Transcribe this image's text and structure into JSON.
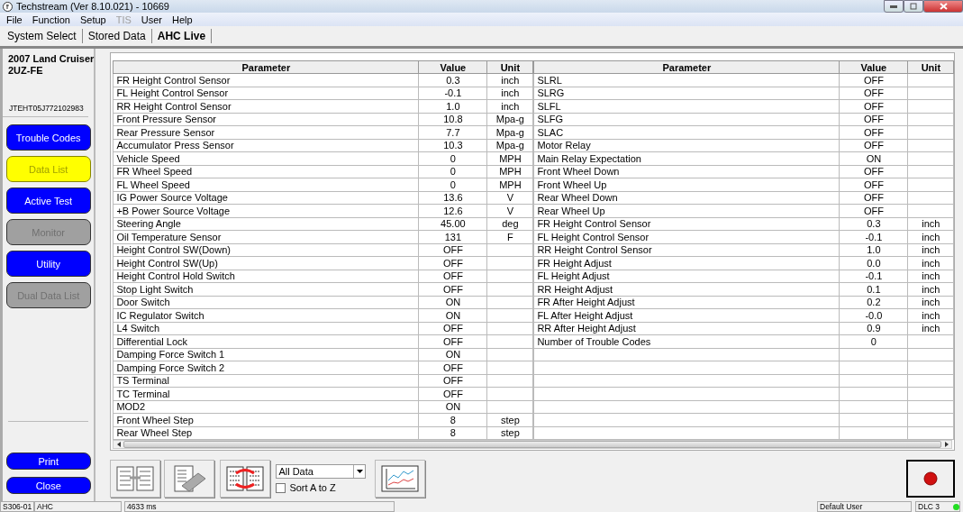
{
  "window": {
    "title": "Techstream (Ver 8.10.021) - 10669"
  },
  "menu": [
    {
      "label": "File",
      "disabled": false
    },
    {
      "label": "Function",
      "disabled": false
    },
    {
      "label": "Setup",
      "disabled": false
    },
    {
      "label": "TIS",
      "disabled": true
    },
    {
      "label": "User",
      "disabled": false
    },
    {
      "label": "Help",
      "disabled": false
    }
  ],
  "tabs": [
    {
      "label": "System Select",
      "selected": false
    },
    {
      "label": "Stored Data",
      "selected": false
    },
    {
      "label": "AHC Live",
      "selected": true
    }
  ],
  "sidebar": {
    "vehicle": [
      "2007 Land Cruiser",
      "2UZ-FE"
    ],
    "vin": "JTEHT05J772102983",
    "buttons": [
      {
        "label": "Trouble Codes",
        "selected": false,
        "disabled": false
      },
      {
        "label": "Data List",
        "selected": true,
        "disabled": false
      },
      {
        "label": "Active Test",
        "selected": false,
        "disabled": false
      },
      {
        "label": "Monitor",
        "selected": false,
        "disabled": true
      },
      {
        "label": "Utility",
        "selected": false,
        "disabled": false
      },
      {
        "label": "Dual Data List",
        "selected": false,
        "disabled": true
      }
    ],
    "actions": [
      "Print",
      "Close"
    ]
  },
  "tables": [
    {
      "columns": [
        "Parameter",
        "Value",
        "Unit"
      ],
      "rows": [
        [
          "FR Height Control Sensor",
          "0.3",
          "inch"
        ],
        [
          "FL Height Control Sensor",
          "-0.1",
          "inch"
        ],
        [
          "RR Height Control Sensor",
          "1.0",
          "inch"
        ],
        [
          "Front Pressure Sensor",
          "10.8",
          "Mpa-g"
        ],
        [
          "Rear Pressure Sensor",
          "7.7",
          "Mpa-g"
        ],
        [
          "Accumulator Press Sensor",
          "10.3",
          "Mpa-g"
        ],
        [
          "Vehicle Speed",
          "0",
          "MPH"
        ],
        [
          "FR Wheel Speed",
          "0",
          "MPH"
        ],
        [
          "FL Wheel Speed",
          "0",
          "MPH"
        ],
        [
          "IG Power Source Voltage",
          "13.6",
          "V"
        ],
        [
          "+B Power Source Voltage",
          "12.6",
          "V"
        ],
        [
          "Steering Angle",
          "45.00",
          "deg"
        ],
        [
          "Oil Temperature Sensor",
          "131",
          "F"
        ],
        [
          "Height Control SW(Down)",
          "OFF",
          ""
        ],
        [
          "Height Control SW(Up)",
          "OFF",
          ""
        ],
        [
          "Height Control Hold Switch",
          "OFF",
          ""
        ],
        [
          "Stop Light Switch",
          "OFF",
          ""
        ],
        [
          "Door Switch",
          "ON",
          ""
        ],
        [
          "IC Regulator Switch",
          "ON",
          ""
        ],
        [
          "L4 Switch",
          "OFF",
          ""
        ],
        [
          "Differential Lock",
          "OFF",
          ""
        ],
        [
          "Damping Force Switch 1",
          "ON",
          ""
        ],
        [
          "Damping Force Switch 2",
          "OFF",
          ""
        ],
        [
          "TS Terminal",
          "OFF",
          ""
        ],
        [
          "TC Terminal",
          "OFF",
          ""
        ],
        [
          "MOD2",
          "ON",
          ""
        ],
        [
          "Front Wheel Step",
          "8",
          "step"
        ],
        [
          "Rear Wheel Step",
          "8",
          "step"
        ]
      ]
    },
    {
      "columns": [
        "Parameter",
        "Value",
        "Unit"
      ],
      "rows": [
        [
          "SLRL",
          "OFF",
          ""
        ],
        [
          "SLRG",
          "OFF",
          ""
        ],
        [
          "SLFL",
          "OFF",
          ""
        ],
        [
          "SLFG",
          "OFF",
          ""
        ],
        [
          "SLAC",
          "OFF",
          ""
        ],
        [
          "Motor Relay",
          "OFF",
          ""
        ],
        [
          "Main Relay Expectation",
          "ON",
          ""
        ],
        [
          "Front Wheel Down",
          "OFF",
          ""
        ],
        [
          "Front Wheel Up",
          "OFF",
          ""
        ],
        [
          "Rear Wheel Down",
          "OFF",
          ""
        ],
        [
          "Rear Wheel Up",
          "OFF",
          ""
        ],
        [
          "FR Height Control Sensor",
          "0.3",
          "inch"
        ],
        [
          "FL Height Control Sensor",
          "-0.1",
          "inch"
        ],
        [
          "RR Height Control Sensor",
          "1.0",
          "inch"
        ],
        [
          "FR Height Adjust",
          "0.0",
          "inch"
        ],
        [
          "FL Height Adjust",
          "-0.1",
          "inch"
        ],
        [
          "RR Height Adjust",
          "0.1",
          "inch"
        ],
        [
          "FR After Height Adjust",
          "0.2",
          "inch"
        ],
        [
          "FL After Height Adjust",
          "-0.0",
          "inch"
        ],
        [
          "RR After Height Adjust",
          "0.9",
          "inch"
        ],
        [
          "Number of Trouble Codes",
          "0",
          ""
        ]
      ]
    }
  ],
  "toolbar": {
    "filter": "All Data",
    "sort": {
      "label": "Sort A to Z",
      "checked": false
    }
  },
  "status_bar": [
    "S306-01",
    "AHC",
    "4633 ms",
    "Default User",
    "DLC 3"
  ]
}
